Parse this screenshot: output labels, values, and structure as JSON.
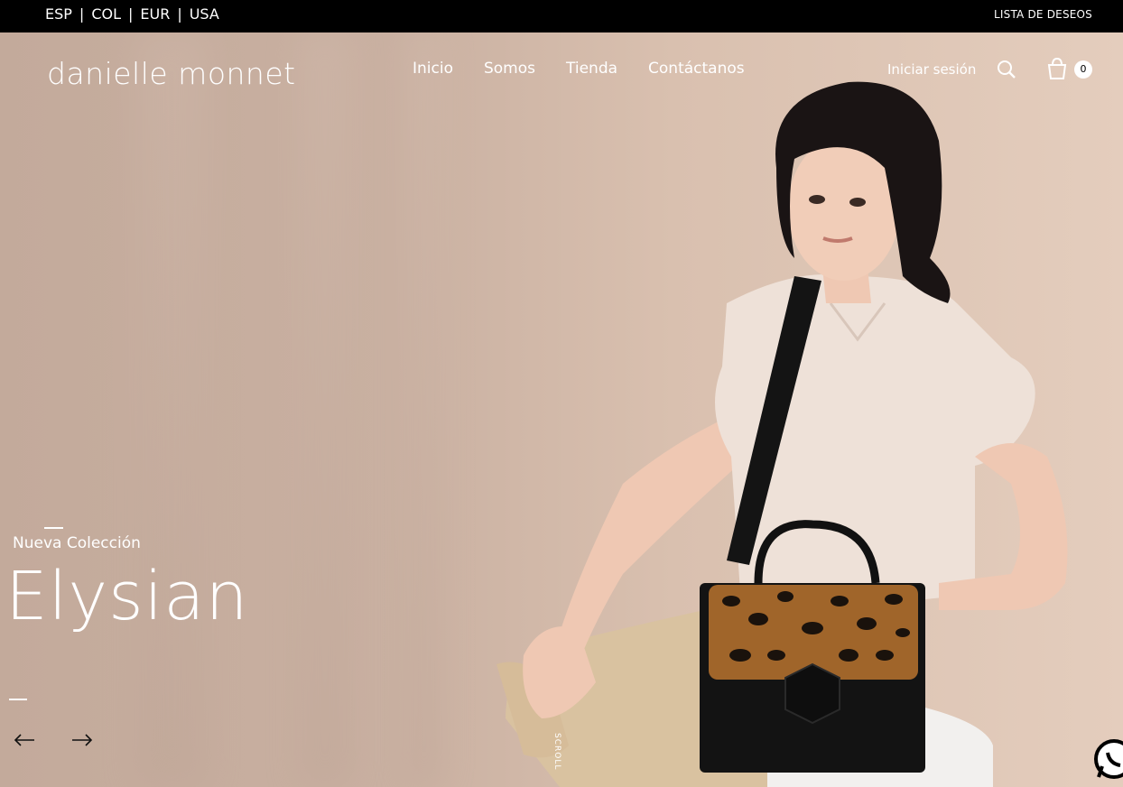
{
  "topbar": {
    "locale": [
      "ESP",
      "COL",
      "EUR",
      "USA"
    ],
    "separator": "|",
    "wishlist": "LISTA DE DESEOS"
  },
  "header": {
    "logo": "danielle monnet",
    "nav": [
      "Inicio",
      "Somos",
      "Tienda",
      "Contáctanos"
    ],
    "login": "Iniciar sesión",
    "cart_count": "0"
  },
  "hero": {
    "subtitle": "Nueva Colección",
    "title": "Elysian",
    "scroll_label": "SCROLL"
  },
  "colors": {
    "topbar_bg": "#000000",
    "text_light": "#ffffff",
    "hero_bg": "#c9b0a2"
  },
  "icons": [
    "search-icon",
    "cart-icon",
    "arrow-left-icon",
    "arrow-right-icon",
    "whatsapp-icon"
  ]
}
